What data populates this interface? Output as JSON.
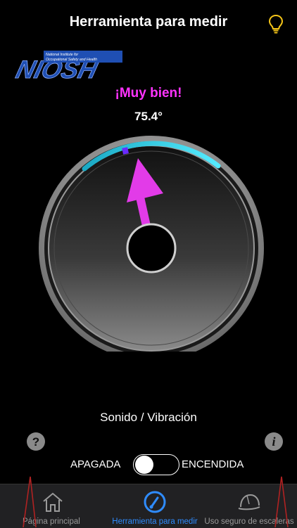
{
  "header": {
    "title": "Herramienta para medir",
    "right_icon": "lightbulb-icon"
  },
  "logo": {
    "text": "NIOSH",
    "subtitle_line1": "National Institute for",
    "subtitle_line2": "Occupational Safety and Health"
  },
  "reading": {
    "status": "¡Muy bien!",
    "angle": "75.4°",
    "status_color": "#ff33ff"
  },
  "mode": {
    "label": "Sonido / Vibración"
  },
  "toggle": {
    "off_label": "APAGADA",
    "on_label": "ENCENDIDA",
    "state": "off"
  },
  "tabs": [
    {
      "label": "Página principal",
      "icon": "home-icon",
      "active": false
    },
    {
      "label": "Herramienta para medir",
      "icon": "gauge-icon",
      "active": true
    },
    {
      "label": "Uso seguro de escaleras",
      "icon": "hard-hat-icon",
      "active": false
    }
  ],
  "colors": {
    "accent": "#2f8cff",
    "arc": "#33e0f0",
    "needle": "#e23be8",
    "background": "#000000"
  }
}
